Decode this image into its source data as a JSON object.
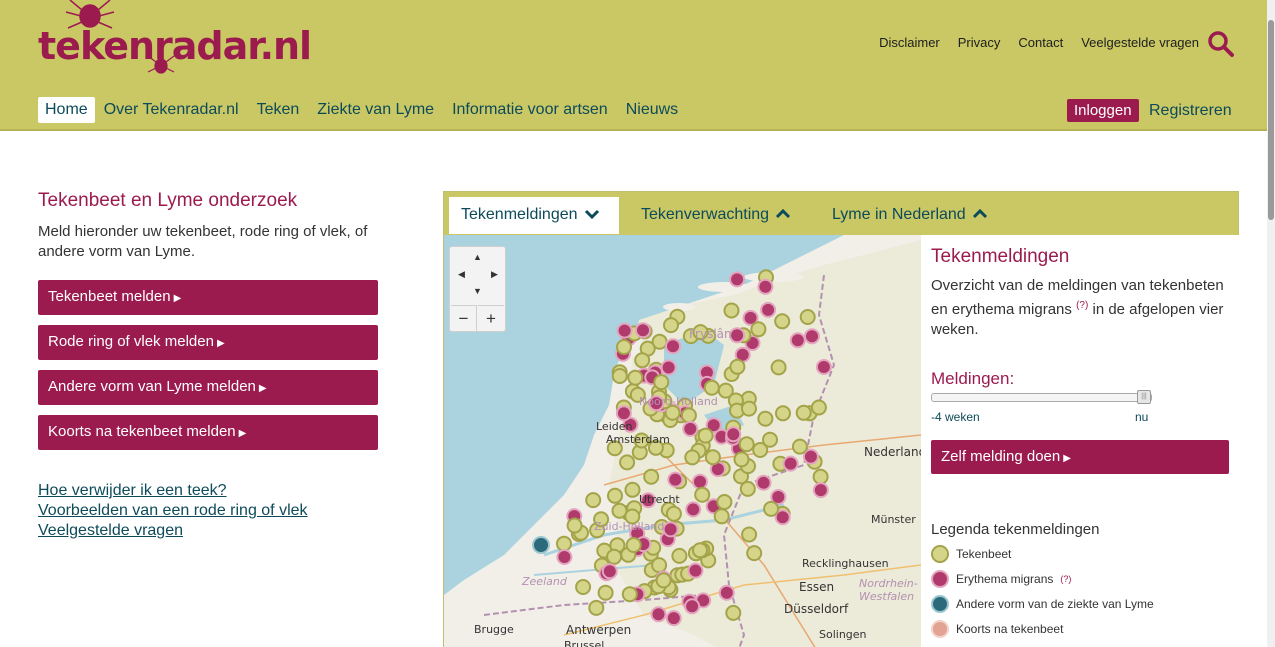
{
  "header": {
    "logo_text": "tekenradar.nl",
    "top_links": [
      "Disclaimer",
      "Privacy",
      "Contact",
      "Veelgestelde vragen"
    ],
    "nav": [
      "Home",
      "Over Tekenradar.nl",
      "Teken",
      "Ziekte van Lyme",
      "Informatie voor artsen",
      "Nieuws"
    ],
    "login_label": "Inloggen",
    "register_label": "Registreren"
  },
  "left": {
    "title": "Tekenbeet en Lyme onderzoek",
    "intro": "Meld hieronder uw tekenbeet, rode ring of vlek, of andere vorm van Lyme.",
    "buttons": [
      "Tekenbeet melden",
      "Rode ring of vlek melden",
      "Andere vorm van Lyme melden",
      "Koorts na tekenbeet melden"
    ],
    "links": [
      "Hoe verwijder ik een teek?",
      "Voorbeelden van een rode ring of vlek",
      "Veelgestelde vragen"
    ]
  },
  "tabs": [
    "Tekenmeldingen",
    "Tekenverwachting",
    "Lyme in Nederland"
  ],
  "sidebar": {
    "title": "Tekenmeldingen",
    "desc_before": "Overzicht van de meldingen van tekenbeten en erythema migrans",
    "desc_sup": "(?)",
    "desc_after": "in de afgelopen vier weken.",
    "meldingen_label": "Meldingen:",
    "slider_min": "-4 weken",
    "slider_max": "nu",
    "slider_value": 1.0,
    "zelf_label": "Zelf melding doen",
    "legend_title": "Legenda tekenmeldingen",
    "legend": [
      {
        "label": "Tekenbeet",
        "sup": "",
        "fill": "#d5d58a",
        "stroke": "#a3a34a"
      },
      {
        "label": "Erythema migrans",
        "sup": "(?)",
        "fill": "#b03a6c",
        "stroke": "#e4a5bf"
      },
      {
        "label": "Andere vorm van de ziekte van Lyme",
        "sup": "",
        "fill": "#2b6a7a",
        "stroke": "#9cc6cf"
      },
      {
        "label": "Koorts na tekenbeet",
        "sup": "",
        "fill": "#e3a393",
        "stroke": "#f3d2c9"
      }
    ]
  },
  "map": {
    "labels": [
      "Zeeland",
      "Amsterdam",
      "Utrecht",
      "Nederland",
      "Essen",
      "Düsseldorf",
      "Münster",
      "Recklinghausen",
      "Nordrhein-Westfalen",
      "Antwerpen",
      "Brugge",
      "Solingen",
      "Fryslân",
      "Noord-Holland",
      "Zuid-Holland",
      "Leiden",
      "Brussel"
    ],
    "zoom_in": "+",
    "zoom_out": "−"
  },
  "colors": {
    "brand": "#9b1b4f",
    "header_bg": "#c9c864",
    "link": "#0d4a5a"
  }
}
